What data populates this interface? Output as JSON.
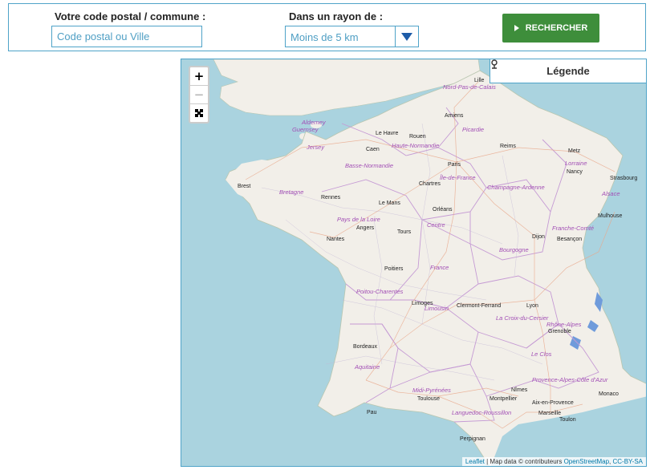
{
  "search": {
    "postal_label": "Votre code postal / commune :",
    "postal_placeholder": "Code postal ou Ville",
    "radius_label": "Dans un rayon de :",
    "radius_value": "Moins de 5 km",
    "button_label": "RECHERCHER"
  },
  "map": {
    "zoom_in": "+",
    "zoom_out": "−",
    "legend_label": "Légende",
    "attribution": {
      "leaflet": "Leaflet",
      "text": " | Map data © contributeurs ",
      "osm": "OpenStreetMap",
      "sep": ", ",
      "license": "CC-BY-SA"
    },
    "cities": [
      "Lille",
      "Amiens",
      "Le Havre",
      "Rouen",
      "Caen",
      "Paris",
      "Reims",
      "Metz",
      "Nancy",
      "Strasbourg",
      "Brest",
      "Rennes",
      "Le Mans",
      "Chartres",
      "Orléans",
      "Angers",
      "Tours",
      "Nantes",
      "Dijon",
      "Besançon",
      "Mulhouse",
      "Poitiers",
      "Limoges",
      "Clermont-Ferrand",
      "Lyon",
      "Grenoble",
      "Bordeaux",
      "Toulouse",
      "Montpellier",
      "Nîmes",
      "Aix-en-Provence",
      "Marseille",
      "Toulon",
      "Pau",
      "Perpignan",
      "Monaco"
    ],
    "regions": [
      "Nord-Pas-de-Calais",
      "Picardie",
      "Haute-Normandie",
      "Basse-Normandie",
      "Île-de-France",
      "Champagne-Ardenne",
      "Lorraine",
      "Alsace",
      "Bretagne",
      "Pays de la Loire",
      "Centre",
      "Franche-Comté",
      "Bourgogne",
      "France",
      "Poitou-Charentes",
      "Limousin",
      "La Croix-du-Cersier",
      "Rhône-Alpes",
      "Aquitaine",
      "Midi-Pyrénées",
      "Languedoc-Roussillon",
      "Provence-Alpes-Côte d'Azur",
      "Alderney",
      "Guernsey",
      "Jersey",
      "Le Clos"
    ]
  },
  "colors": {
    "accent": "#4fa3c8",
    "button": "#3e8e3b",
    "arrow": "#1e5ca8",
    "sea": "#aad3df",
    "land": "#f2efe9",
    "region_label": "#a24fb5"
  }
}
